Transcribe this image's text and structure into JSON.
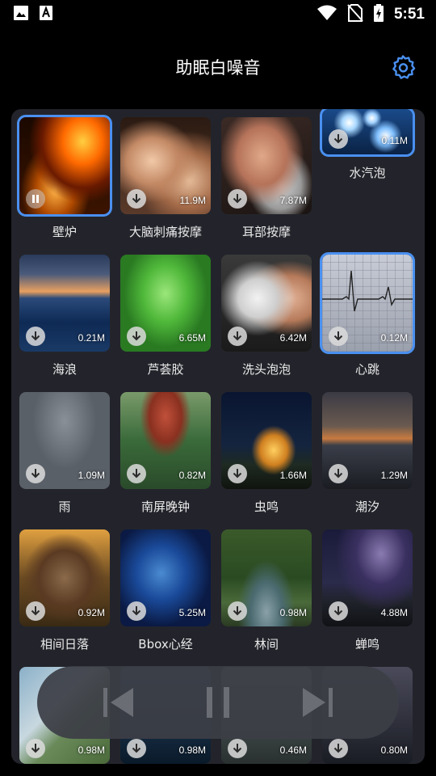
{
  "status": {
    "time": "5:51",
    "icons": [
      "image-icon",
      "text-a-icon",
      "wifi-icon",
      "no-sim-icon",
      "battery-charging-icon"
    ]
  },
  "header": {
    "title": "助眠白噪音",
    "settings_icon": "gear-icon"
  },
  "colors": {
    "accent": "#4a90f0",
    "panel": "#23242b",
    "player": "#3c3e46"
  },
  "sounds": [
    {
      "label": "壁炉",
      "size": "",
      "state": "playing",
      "selected": true,
      "theme": "fireplace"
    },
    {
      "label": "大脑刺痛按摩",
      "size": "11.9M",
      "state": "download",
      "selected": false,
      "theme": "massage"
    },
    {
      "label": "耳部按摩",
      "size": "7.87M",
      "state": "download",
      "selected": false,
      "theme": "ear"
    },
    {
      "label": "水汽泡",
      "size": "0.11M",
      "state": "download",
      "selected": true,
      "theme": "bubbles"
    },
    {
      "label": "海浪",
      "size": "0.21M",
      "state": "download",
      "selected": false,
      "theme": "sea"
    },
    {
      "label": "芦荟胶",
      "size": "6.65M",
      "state": "download",
      "selected": false,
      "theme": "aloe"
    },
    {
      "label": "洗头泡泡",
      "size": "6.42M",
      "state": "download",
      "selected": false,
      "theme": "shampoo"
    },
    {
      "label": "心跳",
      "size": "0.12M",
      "state": "download",
      "selected": true,
      "theme": "ecg"
    },
    {
      "label": "雨",
      "size": "1.09M",
      "state": "download",
      "selected": false,
      "theme": "rain"
    },
    {
      "label": "南屏晚钟",
      "size": "0.82M",
      "state": "download",
      "selected": false,
      "theme": "temple"
    },
    {
      "label": "虫鸣",
      "size": "1.66M",
      "state": "download",
      "selected": false,
      "theme": "tent"
    },
    {
      "label": "潮汐",
      "size": "1.29M",
      "state": "download",
      "selected": false,
      "theme": "coast"
    },
    {
      "label": "相间日落",
      "size": "0.92M",
      "state": "download",
      "selected": false,
      "theme": "barn"
    },
    {
      "label": "Bbox心经",
      "size": "5.25M",
      "state": "download",
      "selected": false,
      "theme": "statue"
    },
    {
      "label": "林间",
      "size": "0.98M",
      "state": "download",
      "selected": false,
      "theme": "forest"
    },
    {
      "label": "蝉鸣",
      "size": "4.88M",
      "state": "download",
      "selected": false,
      "theme": "night"
    },
    {
      "label": "",
      "size": "0.98M",
      "state": "download",
      "selected": false,
      "theme": "branch"
    },
    {
      "label": "",
      "size": "0.98M",
      "state": "download",
      "selected": false,
      "theme": "water"
    },
    {
      "label": "",
      "size": "0.46M",
      "state": "download",
      "selected": false,
      "theme": "mist"
    },
    {
      "label": "",
      "size": "0.80M",
      "state": "download",
      "selected": false,
      "theme": "dusk"
    }
  ],
  "player": {
    "buttons": [
      "skip-previous-icon",
      "pause-icon",
      "skip-next-icon"
    ]
  }
}
